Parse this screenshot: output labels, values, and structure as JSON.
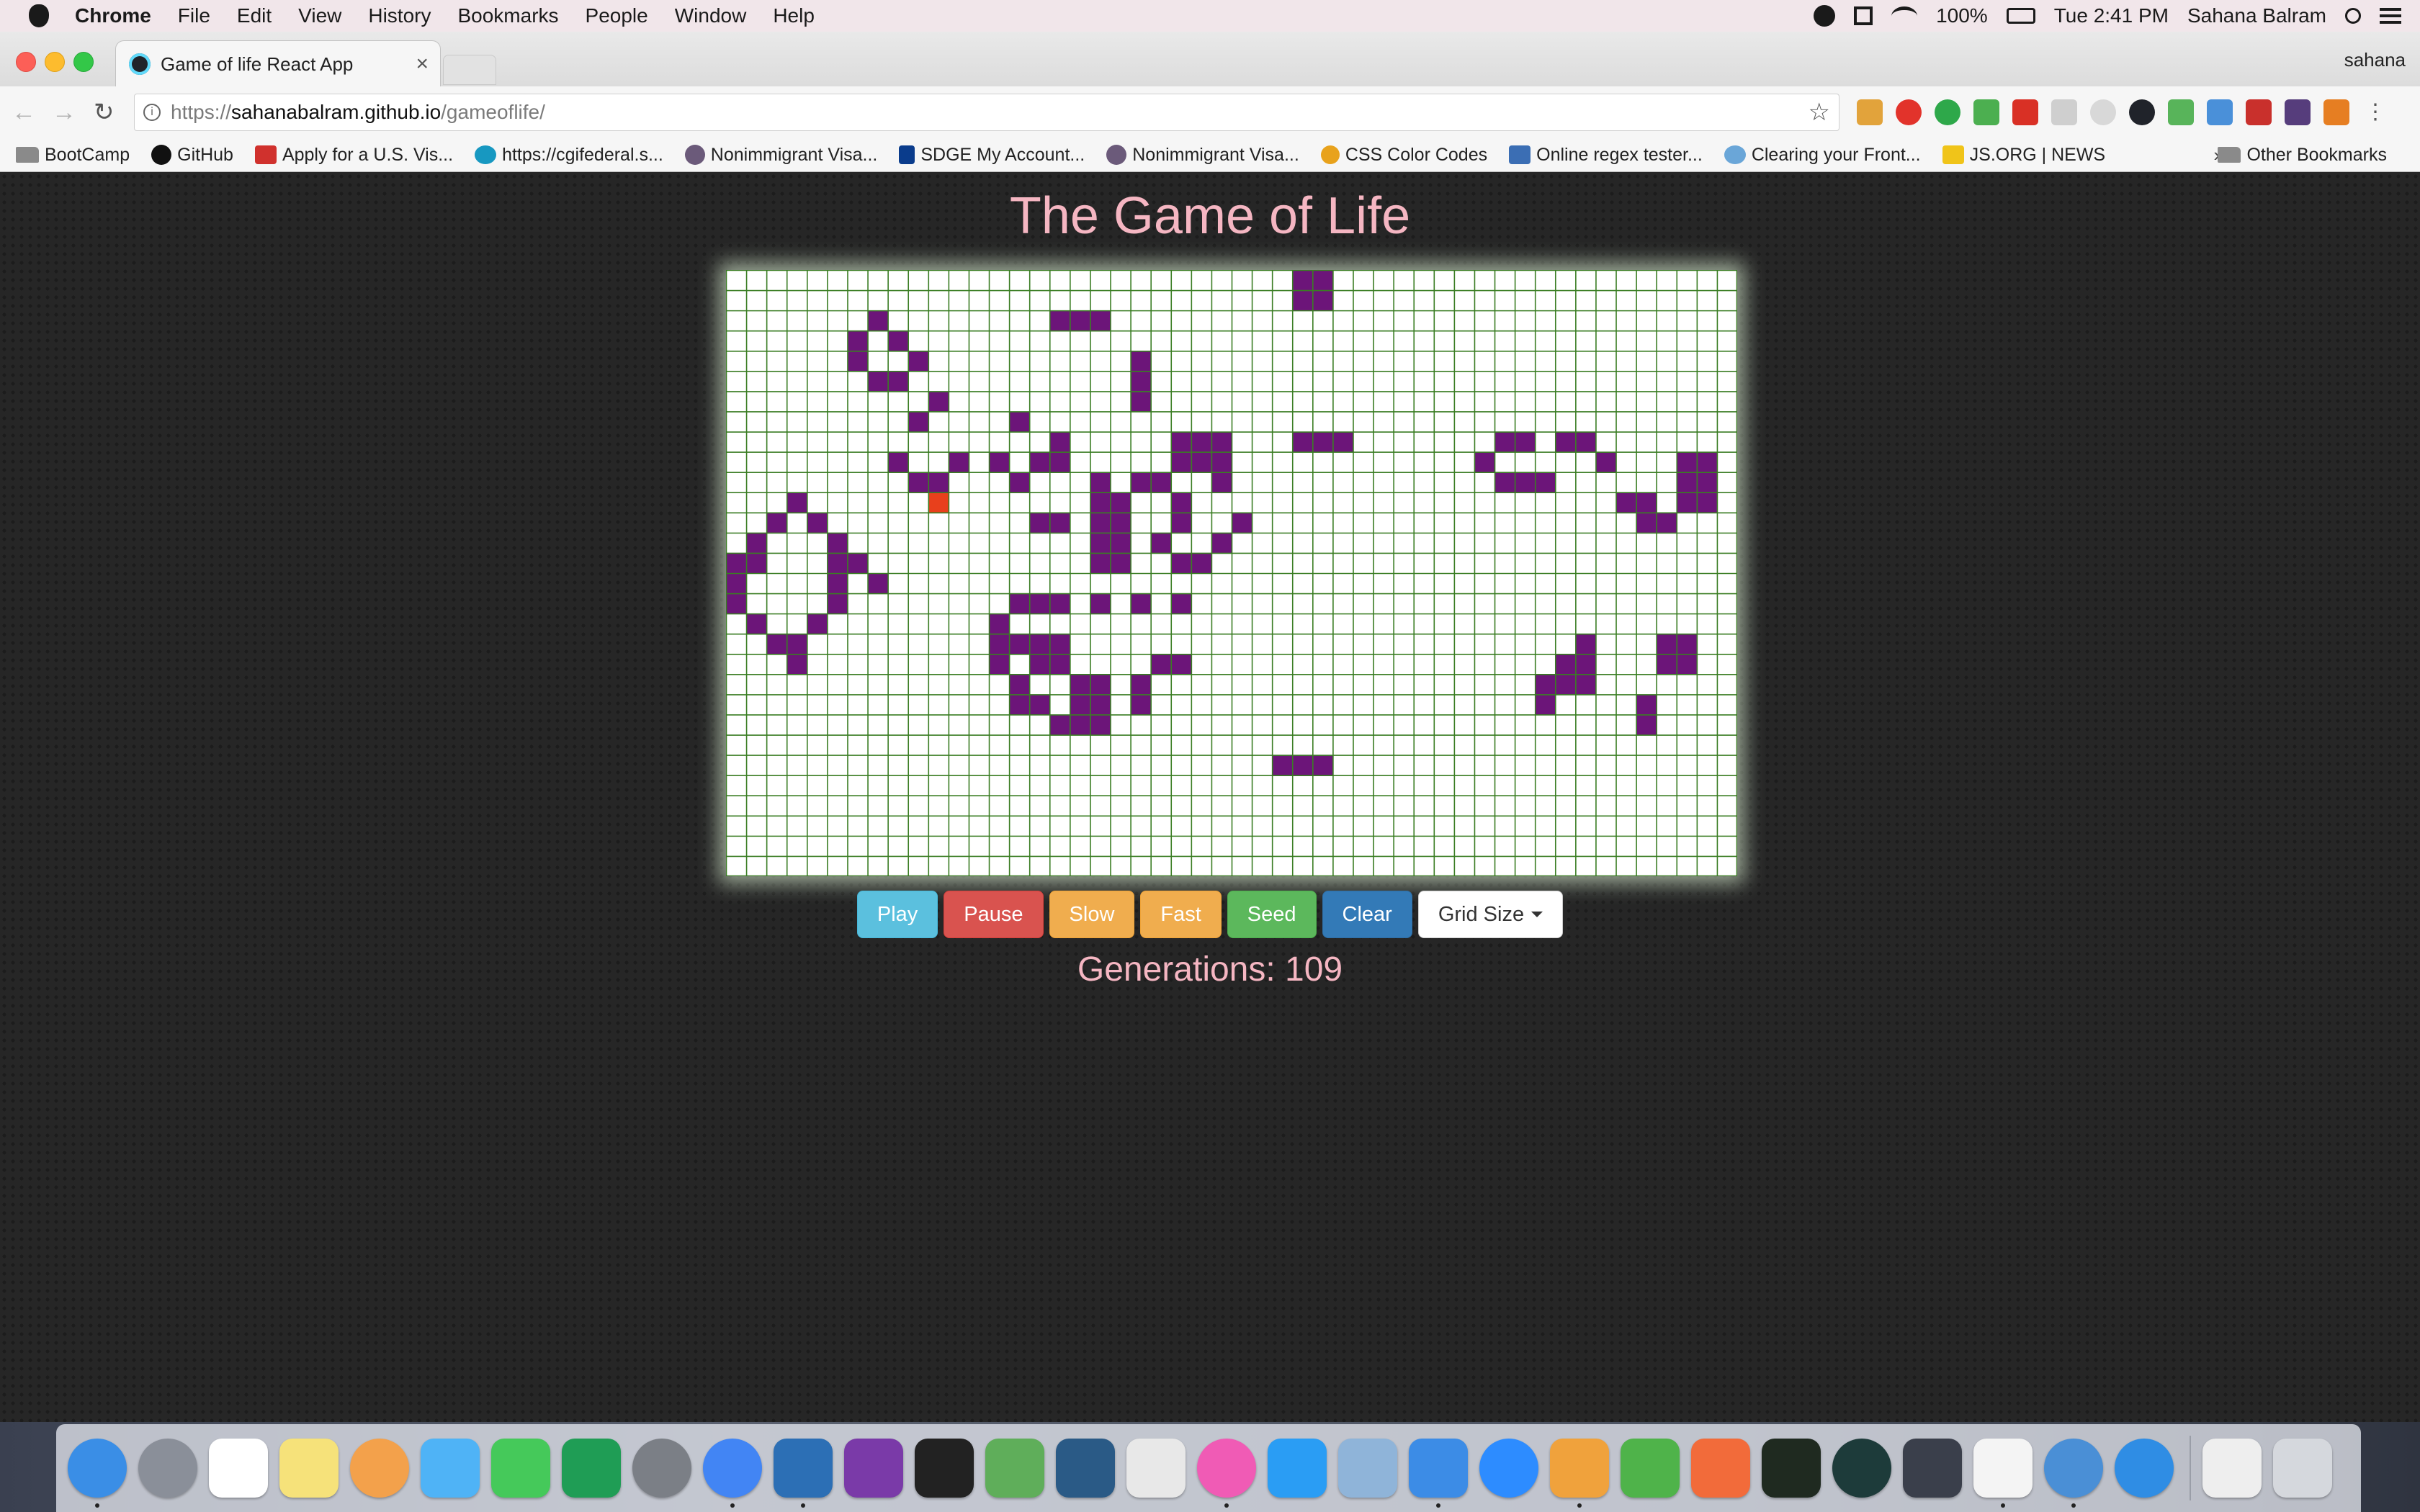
{
  "menubar": {
    "app_name": "Chrome",
    "items": [
      "File",
      "Edit",
      "View",
      "History",
      "Bookmarks",
      "People",
      "Window",
      "Help"
    ],
    "battery": "100%",
    "clock": "Tue 2:41 PM",
    "user": "Sahana Balram"
  },
  "browser": {
    "tab_title": "Game of life React App",
    "profile": "sahana",
    "url_protocol": "https://",
    "url_host": "sahanabalram.github.io",
    "url_path": "/gameoflife/"
  },
  "bookmarks": {
    "items": [
      {
        "label": "BootCamp",
        "icon": "folder-icon",
        "color": "#8a8a8a"
      },
      {
        "label": "GitHub",
        "icon": "github-icon",
        "color": "#111111"
      },
      {
        "label": "Apply for a U.S. Vis...",
        "icon": "cgi-icon",
        "color": "#d0312d"
      },
      {
        "label": "https://cgifederal.s...",
        "icon": "cloud-icon",
        "color": "#1798c1"
      },
      {
        "label": "Nonimmigrant Visa...",
        "icon": "seal-icon",
        "color": "#6b5a7a"
      },
      {
        "label": "SDGE My Account...",
        "icon": "sdge-icon",
        "color": "#0a3c8c"
      },
      {
        "label": "Nonimmigrant Visa...",
        "icon": "seal-icon",
        "color": "#6b5a7a"
      },
      {
        "label": "CSS Color Codes",
        "icon": "search-icon",
        "color": "#e8a21c"
      },
      {
        "label": "Online regex tester...",
        "icon": "regex-icon",
        "color": "#3b6eb4"
      },
      {
        "label": "Clearing your Front...",
        "icon": "page-icon",
        "color": "#6aa6d8"
      },
      {
        "label": "JS.ORG | NEWS",
        "icon": "js-icon",
        "color": "#f0c419"
      }
    ],
    "more": "»",
    "other": "Other Bookmarks"
  },
  "page": {
    "title": "The Game of Life",
    "buttons": {
      "play": "Play",
      "pause": "Pause",
      "slow": "Slow",
      "fast": "Fast",
      "seed": "Seed",
      "clear": "Clear",
      "grid_size": "Grid Size"
    },
    "generations": "Generations: 109"
  },
  "board": {
    "cols": 50,
    "rows": 30,
    "colors": {
      "background": "#ffffff",
      "grid_line": "#3a7d23",
      "alive": "#6c1579",
      "newborn": "#e8401c"
    },
    "alive_cells": [
      [
        28,
        0
      ],
      [
        29,
        0
      ],
      [
        28,
        1
      ],
      [
        29,
        1
      ],
      [
        7,
        2
      ],
      [
        16,
        2
      ],
      [
        17,
        2
      ],
      [
        18,
        2
      ],
      [
        6,
        3
      ],
      [
        8,
        3
      ],
      [
        6,
        4
      ],
      [
        9,
        4
      ],
      [
        20,
        4
      ],
      [
        7,
        5
      ],
      [
        8,
        5
      ],
      [
        20,
        5
      ],
      [
        10,
        6
      ],
      [
        20,
        6
      ],
      [
        9,
        7
      ],
      [
        14,
        7
      ],
      [
        16,
        8
      ],
      [
        22,
        8
      ],
      [
        23,
        8
      ],
      [
        24,
        8
      ],
      [
        28,
        8
      ],
      [
        29,
        8
      ],
      [
        30,
        8
      ],
      [
        38,
        8
      ],
      [
        39,
        8
      ],
      [
        41,
        8
      ],
      [
        42,
        8
      ],
      [
        8,
        9
      ],
      [
        11,
        9
      ],
      [
        13,
        9
      ],
      [
        15,
        9
      ],
      [
        16,
        9
      ],
      [
        22,
        9
      ],
      [
        23,
        9
      ],
      [
        24,
        9
      ],
      [
        37,
        9
      ],
      [
        43,
        9
      ],
      [
        47,
        9
      ],
      [
        48,
        9
      ],
      [
        9,
        10
      ],
      [
        10,
        10
      ],
      [
        14,
        10
      ],
      [
        18,
        10
      ],
      [
        20,
        10
      ],
      [
        21,
        10
      ],
      [
        24,
        10
      ],
      [
        38,
        10
      ],
      [
        39,
        10
      ],
      [
        40,
        10
      ],
      [
        47,
        10
      ],
      [
        48,
        10
      ],
      [
        3,
        11
      ],
      [
        18,
        11
      ],
      [
        19,
        11
      ],
      [
        22,
        11
      ],
      [
        44,
        11
      ],
      [
        45,
        11
      ],
      [
        47,
        11
      ],
      [
        48,
        11
      ],
      [
        2,
        12
      ],
      [
        4,
        12
      ],
      [
        15,
        12
      ],
      [
        16,
        12
      ],
      [
        18,
        12
      ],
      [
        19,
        12
      ],
      [
        22,
        12
      ],
      [
        25,
        12
      ],
      [
        45,
        12
      ],
      [
        46,
        12
      ],
      [
        1,
        13
      ],
      [
        5,
        13
      ],
      [
        18,
        13
      ],
      [
        19,
        13
      ],
      [
        21,
        13
      ],
      [
        24,
        13
      ],
      [
        0,
        14
      ],
      [
        1,
        14
      ],
      [
        5,
        14
      ],
      [
        6,
        14
      ],
      [
        18,
        14
      ],
      [
        19,
        14
      ],
      [
        22,
        14
      ],
      [
        23,
        14
      ],
      [
        0,
        15
      ],
      [
        5,
        15
      ],
      [
        7,
        15
      ],
      [
        0,
        16
      ],
      [
        5,
        16
      ],
      [
        14,
        16
      ],
      [
        15,
        16
      ],
      [
        16,
        16
      ],
      [
        18,
        16
      ],
      [
        20,
        16
      ],
      [
        22,
        16
      ],
      [
        1,
        17
      ],
      [
        4,
        17
      ],
      [
        13,
        17
      ],
      [
        2,
        18
      ],
      [
        3,
        18
      ],
      [
        13,
        18
      ],
      [
        14,
        18
      ],
      [
        15,
        18
      ],
      [
        16,
        18
      ],
      [
        42,
        18
      ],
      [
        46,
        18
      ],
      [
        47,
        18
      ],
      [
        3,
        19
      ],
      [
        13,
        19
      ],
      [
        15,
        19
      ],
      [
        16,
        19
      ],
      [
        21,
        19
      ],
      [
        22,
        19
      ],
      [
        41,
        19
      ],
      [
        42,
        19
      ],
      [
        46,
        19
      ],
      [
        47,
        19
      ],
      [
        14,
        20
      ],
      [
        17,
        20
      ],
      [
        18,
        20
      ],
      [
        20,
        20
      ],
      [
        40,
        20
      ],
      [
        41,
        20
      ],
      [
        42,
        20
      ],
      [
        14,
        21
      ],
      [
        15,
        21
      ],
      [
        17,
        21
      ],
      [
        18,
        21
      ],
      [
        20,
        21
      ],
      [
        40,
        21
      ],
      [
        45,
        21
      ],
      [
        16,
        22
      ],
      [
        17,
        22
      ],
      [
        18,
        22
      ],
      [
        45,
        22
      ],
      [
        27,
        24
      ],
      [
        28,
        24
      ],
      [
        29,
        24
      ]
    ],
    "newborn_cells": [
      [
        10,
        11
      ]
    ]
  },
  "dock": {
    "apps": [
      {
        "name": "finder-icon",
        "color": "#3a8ee6"
      },
      {
        "name": "launchpad-icon",
        "color": "#8a8f99"
      },
      {
        "name": "calendar-icon",
        "color": "#ffffff"
      },
      {
        "name": "notes-icon",
        "color": "#f6e27a"
      },
      {
        "name": "photos-icon",
        "color": "#f3a14b"
      },
      {
        "name": "messages-icon",
        "color": "#4fb3f6"
      },
      {
        "name": "facetime-icon",
        "color": "#45c95a"
      },
      {
        "name": "hangouts-icon",
        "color": "#1f9d55"
      },
      {
        "name": "system-preferences-icon",
        "color": "#7b7f86"
      },
      {
        "name": "chrome-icon",
        "color": "#4285f4"
      },
      {
        "name": "vscode-icon",
        "color": "#2c6fb5"
      },
      {
        "name": "onenote-icon",
        "color": "#7a3aa8"
      },
      {
        "name": "terminal-icon",
        "color": "#222222"
      },
      {
        "name": "rocket-icon",
        "color": "#5fae5a"
      },
      {
        "name": "mysql-icon",
        "color": "#2a5a86"
      },
      {
        "name": "slides-icon",
        "color": "#e8e8e8"
      },
      {
        "name": "itunes-icon",
        "color": "#f05bb5"
      },
      {
        "name": "app-store-icon",
        "color": "#2a9df4"
      },
      {
        "name": "preview-icon",
        "color": "#8fb4d9"
      },
      {
        "name": "keynote-icon",
        "color": "#3c8ce6"
      },
      {
        "name": "zoom-icon",
        "color": "#2d8cff"
      },
      {
        "name": "pages-icon",
        "color": "#f0a23c"
      },
      {
        "name": "numbers-icon",
        "color": "#4fb34a"
      },
      {
        "name": "postman-icon",
        "color": "#f26b3a"
      },
      {
        "name": "activity-monitor-icon",
        "color": "#1f2a20"
      },
      {
        "name": "gitkraken-icon",
        "color": "#1d3b3a"
      },
      {
        "name": "code-editor-icon",
        "color": "#3a3f4b"
      },
      {
        "name": "document-icon",
        "color": "#f4f4f4"
      },
      {
        "name": "sequel-pro-icon",
        "color": "#4a8fd6"
      },
      {
        "name": "safari-icon",
        "color": "#2f8de4"
      }
    ],
    "stack": [
      {
        "name": "archive-icon",
        "color": "#eeeeee"
      },
      {
        "name": "trash-icon",
        "color": "#d5d8dd"
      }
    ]
  }
}
